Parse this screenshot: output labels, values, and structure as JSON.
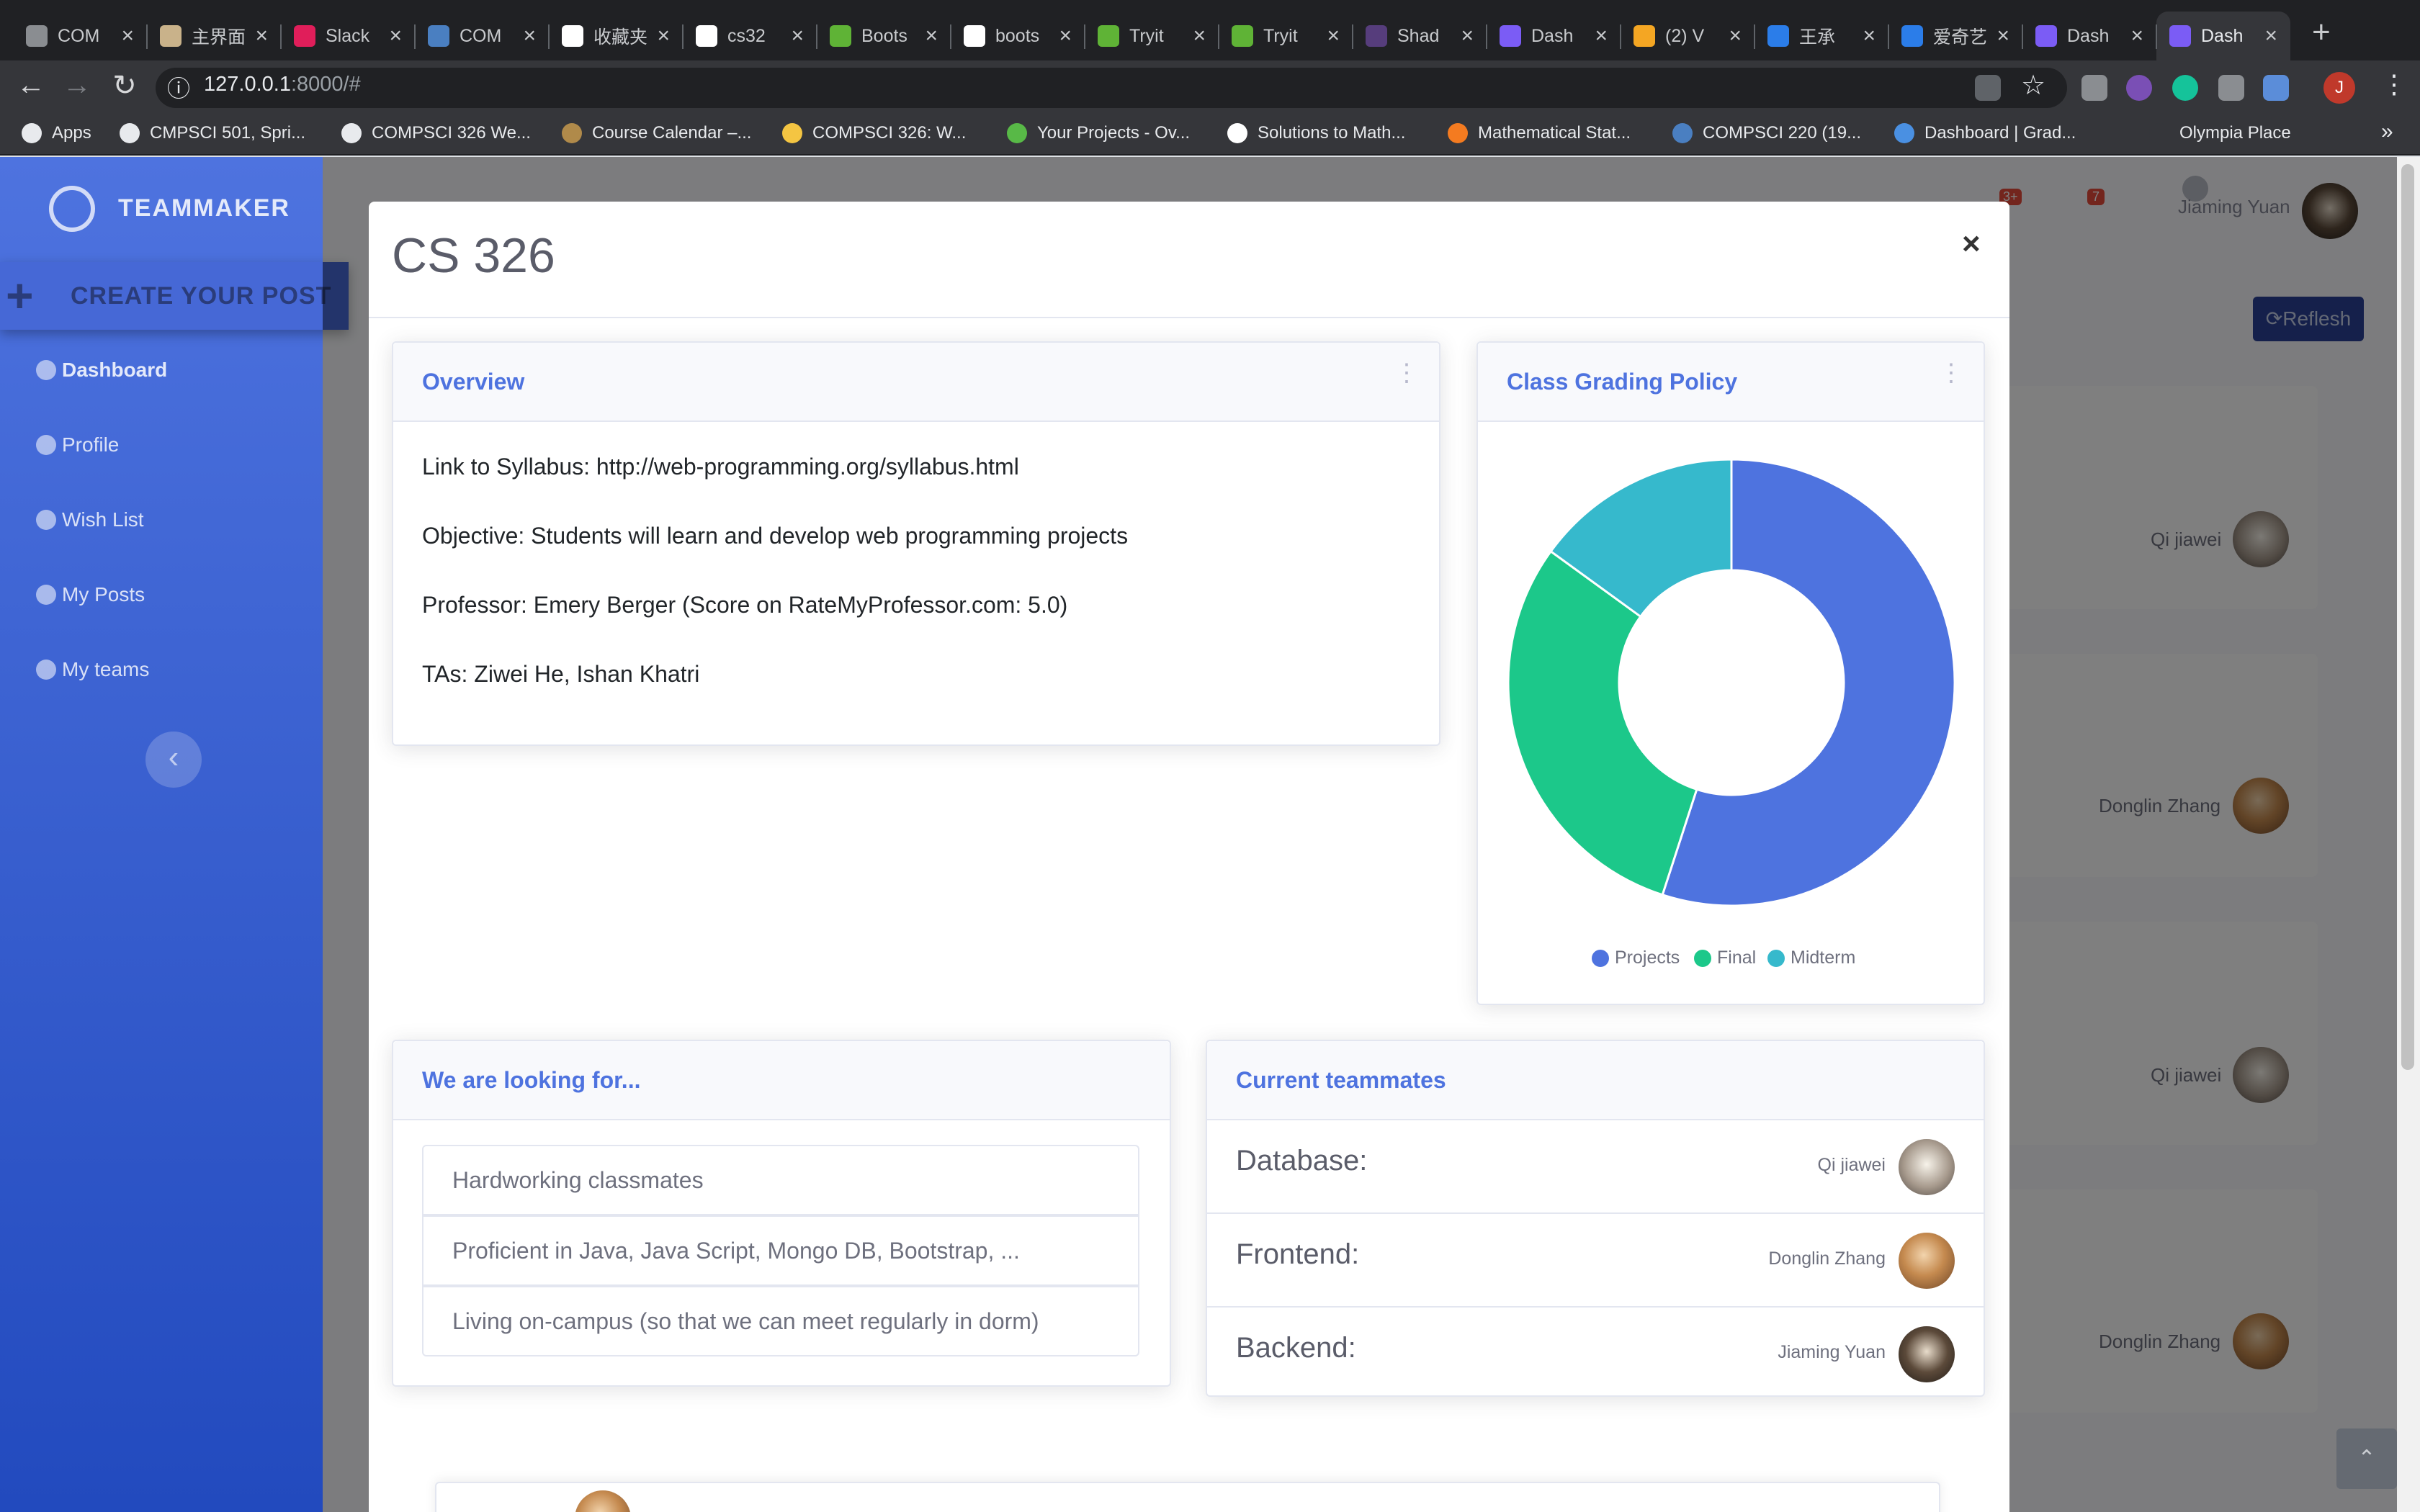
{
  "browser": {
    "tabs": [
      {
        "label": "COM",
        "fav": "#8a8d91"
      },
      {
        "label": "主界面",
        "fav": "#c9b28a"
      },
      {
        "label": "Slack",
        "fav": "#e01e5a"
      },
      {
        "label": "COM",
        "fav": "#4a7fc1"
      },
      {
        "label": "收藏夹",
        "fav": "#ffffff"
      },
      {
        "label": "cs32",
        "fav": "#ffffff"
      },
      {
        "label": "Boots",
        "fav": "#5fb336"
      },
      {
        "label": "boots",
        "fav": "#ffffff"
      },
      {
        "label": "Tryit",
        "fav": "#5fb336"
      },
      {
        "label": "Tryit",
        "fav": "#5fb336"
      },
      {
        "label": "Shad",
        "fav": "#563d7c"
      },
      {
        "label": "Dash",
        "fav": "#7b5cf5"
      },
      {
        "label": "(2) V",
        "fav": "#f4a623"
      },
      {
        "label": "王承",
        "fav": "#2b7de9"
      },
      {
        "label": "爱奇艺",
        "fav": "#2b7de9"
      },
      {
        "label": "Dash",
        "fav": "#7b5cf5"
      },
      {
        "label": "Dash",
        "fav": "#7b5cf5"
      }
    ],
    "tab_close_glyph": "×",
    "new_tab_glyph": "+",
    "url_host": "127.0.0.1",
    "url_rest": ":8000/#",
    "nav": {
      "back": "←",
      "forward": "→",
      "reload": "↻",
      "info": "ⓘ"
    },
    "profile_initial": "J",
    "bookmarks": [
      {
        "label": "Apps",
        "color": "#e8eaed"
      },
      {
        "label": "CMPSCI 501, Spri...",
        "color": "#e8eaed"
      },
      {
        "label": "COMPSCI 326 We...",
        "color": "#e8eaed"
      },
      {
        "label": "Course Calendar –...",
        "color": "#b08a4a"
      },
      {
        "label": "COMPSCI 326: W...",
        "color": "#f4c542"
      },
      {
        "label": "Your Projects - Ov...",
        "color": "#58b947"
      },
      {
        "label": "Solutions to Math...",
        "color": "#ffffff"
      },
      {
        "label": "Mathematical Stat...",
        "color": "#f47b20"
      },
      {
        "label": "COMPSCI 220 (19...",
        "color": "#4a7fc1"
      },
      {
        "label": "Dashboard | Grad...",
        "color": "#4a90e2"
      },
      {
        "label": "Olympia Place",
        "color": "#35363a"
      }
    ],
    "bookmarks_more": "»"
  },
  "sidebar": {
    "brand": "TEAMMAKER",
    "create_post": "CREATE YOUR POST",
    "items": [
      {
        "label": "Dashboard"
      },
      {
        "label": "Profile"
      },
      {
        "label": "Wish List"
      },
      {
        "label": "My Posts"
      },
      {
        "label": "My teams"
      }
    ],
    "collapse_glyph": "‹"
  },
  "topbar": {
    "alerts_badge": "3+",
    "messages_badge": "7",
    "user_name": "Jiaming Yuan"
  },
  "background": {
    "refresh_label": "Reflesh",
    "names": [
      "Qi jiawei",
      "Donglin Zhang",
      "Qi jiawei",
      "Donglin Zhang"
    ],
    "totop_glyph": "⌃"
  },
  "modal": {
    "title": "CS 326",
    "close_glyph": "×",
    "overview": {
      "title": "Overview",
      "lines": [
        "Link to Syllabus: http://web-programming.org/syllabus.html",
        "Objective: Students will learn and develop web programming projects",
        "Professor: Emery Berger (Score on RateMyProfessor.com: 5.0)",
        "TAs: Ziwei He, Ishan Khatri"
      ]
    },
    "grading": {
      "title": "Class Grading Policy"
    },
    "looking_for": {
      "title": "We are looking for...",
      "items": [
        "Hardworking classmates",
        "Proficient in Java, Java Script, Mongo DB, Bootstrap, ...",
        "Living on-campus (so that we can meet regularly in dorm)"
      ]
    },
    "teammates": {
      "title": "Current teammates",
      "rows": [
        {
          "role": "Database:",
          "name": "Qi jiawei"
        },
        {
          "role": "Frontend:",
          "name": "Donglin Zhang"
        },
        {
          "role": "Backend:",
          "name": "Jiaming Yuan"
        }
      ]
    }
  },
  "chart_data": {
    "type": "pie",
    "categories": [
      "Projects",
      "Final",
      "Midterm"
    ],
    "values": [
      55,
      30,
      15
    ],
    "colors": [
      "#4e73df",
      "#1cc88a",
      "#36b9cc"
    ],
    "donut": true,
    "legend": "bottom"
  }
}
